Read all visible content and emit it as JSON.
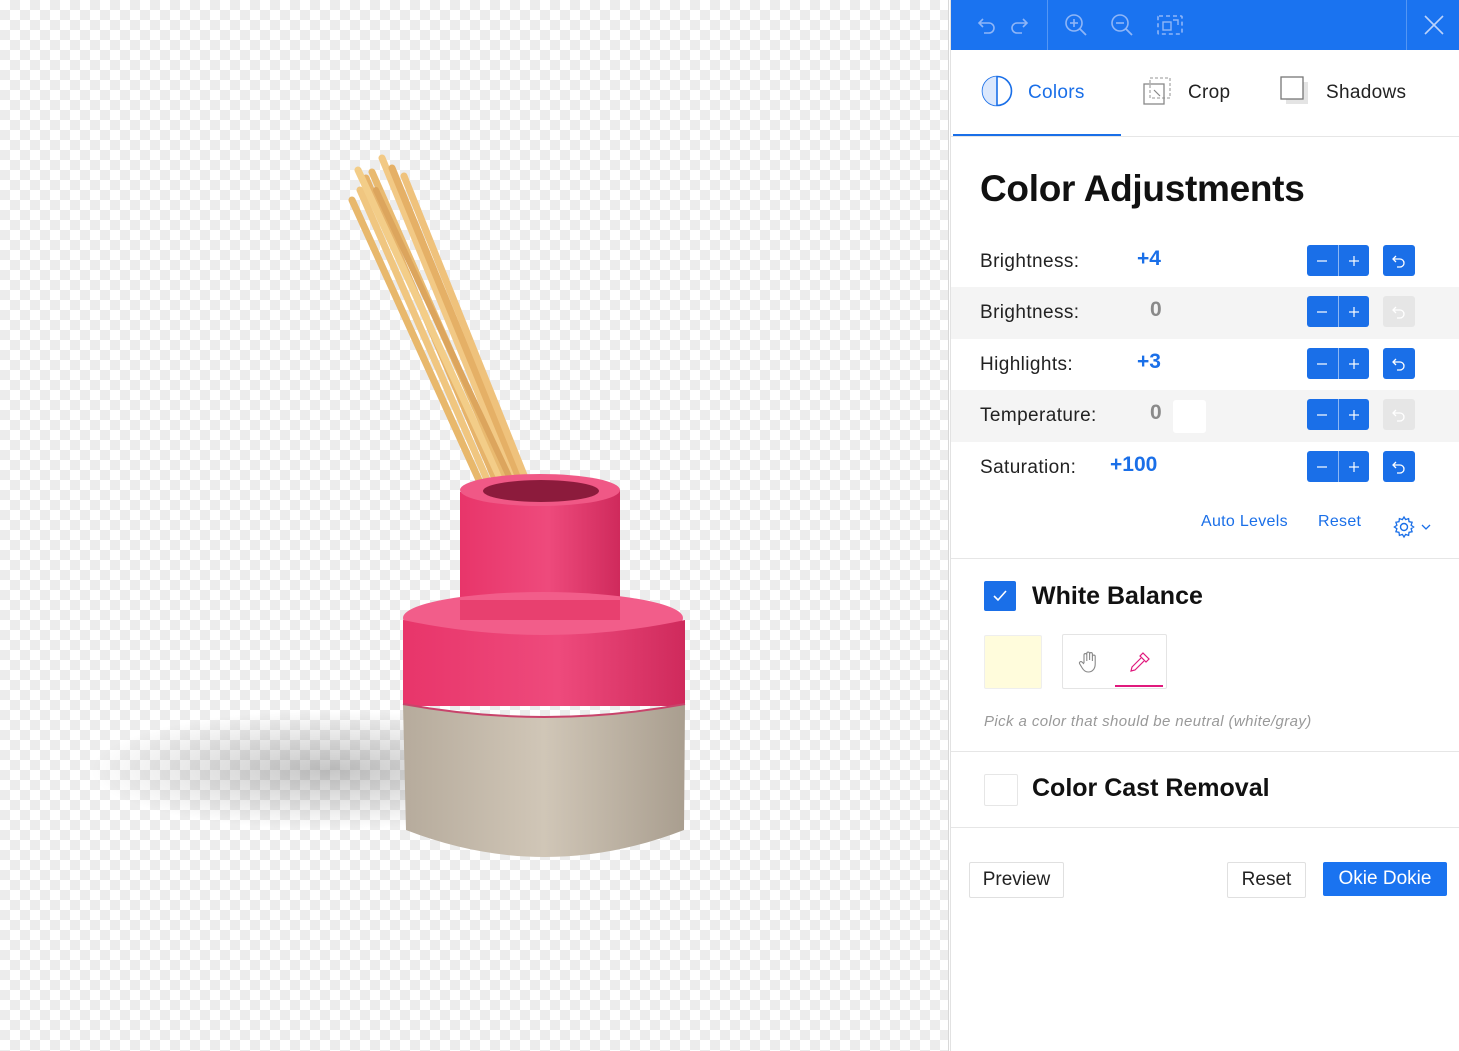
{
  "toolbar": {
    "icons": [
      "undo-icon",
      "redo-icon",
      "zoom-in-icon",
      "zoom-out-icon",
      "fit-screen-icon",
      "close-icon"
    ],
    "background": "#1a73f0"
  },
  "tabs": [
    {
      "label": "Colors",
      "icon": "colors-icon",
      "active": true
    },
    {
      "label": "Crop",
      "icon": "crop-icon",
      "active": false
    },
    {
      "label": "Shadows",
      "icon": "shadows-icon",
      "active": false
    }
  ],
  "panel_title": "Color Adjustments",
  "adjustments": [
    {
      "label": "Brightness:",
      "value": "+4",
      "changed": true
    },
    {
      "label": "Brightness:",
      "value": "0",
      "changed": false
    },
    {
      "label": "Highlights:",
      "value": "+3",
      "changed": true
    },
    {
      "label": "Temperature:",
      "value": "0",
      "changed": false
    },
    {
      "label": "Saturation:",
      "value": "+100",
      "changed": true
    }
  ],
  "actions": {
    "auto_levels": "Auto Levels",
    "reset": "Reset"
  },
  "white_balance": {
    "title": "White Balance",
    "checked": true,
    "selected_color": "#fffcdc",
    "hint": "Pick a color that should be neutral (white/gray)"
  },
  "color_cast": {
    "title": "Color Cast Removal",
    "checked": false
  },
  "footer": {
    "preview": "Preview",
    "reset": "Reset",
    "confirm": "Okie Dokie"
  },
  "colors": {
    "accent": "#1a73f0",
    "active_tab": "#1a6fe8",
    "eyedropper": "#e0197d"
  }
}
